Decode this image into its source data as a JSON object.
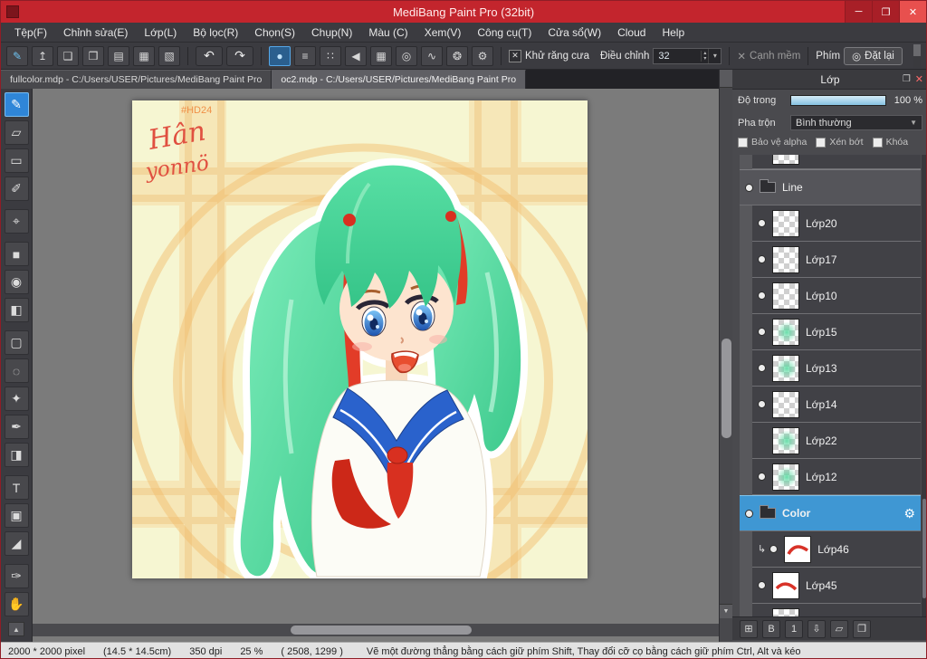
{
  "titlebar": {
    "title": "MediBang Paint Pro (32bit)"
  },
  "window_controls": {
    "minimize": "─",
    "maximize": "❐",
    "close": "✕"
  },
  "menu": {
    "items": [
      "Tệp(F)",
      "Chỉnh sửa(E)",
      "Lớp(L)",
      "Bộ lọc(R)",
      "Chọn(S)",
      "Chụp(N)",
      "Màu (C)",
      "Xem(V)",
      "Công cụ(T)",
      "Cửa sổ(W)",
      "Cloud",
      "Help"
    ]
  },
  "toolbar": {
    "icons": {
      "brush_presets": "✎",
      "upload": "↥",
      "comment": "❑",
      "comment_filled": "❒",
      "pages": "▤",
      "pages_grid": "▦",
      "panels": "▧",
      "undo": "↶",
      "redo": "↷",
      "round_brush": "●",
      "flat_brush": "≡",
      "dot_brush": "∷",
      "triangle_brush": "◀",
      "halftone": "▦",
      "concentric": "◎",
      "curve": "∿",
      "symmetry": "❂",
      "settings_gear": "⚙",
      "checkbox_x": "✕",
      "spinner_up": "▴",
      "spinner_down": "▾",
      "dropdown": "▾",
      "soft_x": "✕",
      "reset_icon": "◎"
    },
    "antialias_label": "Khử răng cưa",
    "adjust_label": "Điều chỉnh",
    "adjust_value": "32",
    "soft_edge_label": "Cạnh mềm",
    "key_label": "Phím",
    "reset_label": "Đặt lại"
  },
  "tabs": {
    "items": [
      {
        "label": "fullcolor.mdp - C:/Users/USER/Pictures/MediBang Paint Pro"
      },
      {
        "label": "oc2.mdp - C:/Users/USER/Pictures/MediBang Paint Pro"
      }
    ]
  },
  "tools": {
    "items": [
      {
        "name": "brush",
        "glyph": "✎"
      },
      {
        "name": "eraser",
        "glyph": "▱"
      },
      {
        "name": "shape-brush",
        "glyph": "▭"
      },
      {
        "name": "airbrush",
        "glyph": "✐"
      },
      {
        "name": "move",
        "glyph": "⌖"
      },
      {
        "name": "select-all",
        "glyph": "■"
      },
      {
        "name": "bucket",
        "glyph": "◉"
      },
      {
        "name": "gradient",
        "glyph": "◧"
      },
      {
        "name": "marquee",
        "glyph": "▢"
      },
      {
        "name": "lasso",
        "glyph": "◌"
      },
      {
        "name": "magic-wand",
        "glyph": "✦"
      },
      {
        "name": "select-pen",
        "glyph": "✒"
      },
      {
        "name": "select-eraser",
        "glyph": "◨"
      },
      {
        "name": "text",
        "glyph": "T"
      },
      {
        "name": "transform",
        "glyph": "▣"
      },
      {
        "name": "eyedropper",
        "glyph": "◢"
      },
      {
        "name": "pen",
        "glyph": "✑"
      },
      {
        "name": "hand",
        "glyph": "✋"
      }
    ]
  },
  "ui_icons": {
    "scroll_down": "▼",
    "scroll_up": "▲",
    "popout": "❐",
    "close": "✕"
  },
  "layers": {
    "panel_title": "Lớp",
    "opacity_label": "Độ trong",
    "opacity_value": "100 %",
    "blend_label": "Pha trộn",
    "blend_value": "Bình thường",
    "alpha_label": "Bảo vệ alpha",
    "clip_label": "Xén bớt",
    "lock_label": "Khóa",
    "gear_icon": "⚙",
    "clip_arrow": "↳",
    "items": [
      {
        "name": "Line"
      },
      {
        "name": "Lớp20"
      },
      {
        "name": "Lớp17"
      },
      {
        "name": "Lớp10"
      },
      {
        "name": "Lớp15"
      },
      {
        "name": "Lớp13"
      },
      {
        "name": "Lớp14"
      },
      {
        "name": "Lớp22"
      },
      {
        "name": "Lớp12"
      },
      {
        "name": "Color"
      },
      {
        "name": "Lớp46"
      },
      {
        "name": "Lớp45"
      }
    ],
    "ops": [
      {
        "name": "add-layer",
        "glyph": "⊞"
      },
      {
        "name": "add-8bit-layer",
        "glyph": "B"
      },
      {
        "name": "add-1bit-layer",
        "glyph": "1"
      },
      {
        "name": "merge-down",
        "glyph": "⇩"
      },
      {
        "name": "add-folder",
        "glyph": "▱"
      },
      {
        "name": "duplicate-layer",
        "glyph": "❐"
      }
    ]
  },
  "canvas": {
    "signature_line1": "Hân",
    "signature_line2": "yonnö",
    "tag": "#HD24"
  },
  "statusbar": {
    "size": "2000 * 2000 pixel",
    "cm": "(14.5 * 14.5cm)",
    "dpi": "350 dpi",
    "zoom": "25 %",
    "coords": "( 2508, 1299 )",
    "hint": "Vẽ một đường thẳng bằng cách giữ phím Shift, Thay đổi cỡ cọ bằng cách giữ phím Ctrl, Alt và kéo"
  }
}
